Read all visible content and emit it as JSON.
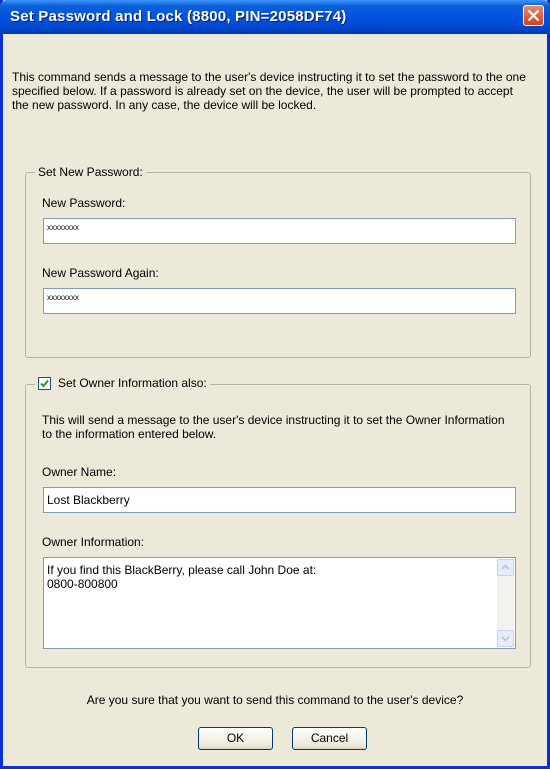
{
  "window": {
    "title": "Set Password and Lock (8800, PIN=2058DF74)"
  },
  "intro": {
    "text": "This command sends a message to the user's device instructing it to set the password to the one specified below. If a password is already set on the device, the user will be prompted to accept the new password. In any case, the device will be locked."
  },
  "password_group": {
    "legend": "Set New Password:",
    "new_password_label": "New Password:",
    "new_password_value": "xxxxxxxx",
    "again_label": "New Password Again:",
    "again_value": "xxxxxxxx"
  },
  "owner_group": {
    "checkbox_label": "Set Owner Information also:",
    "checked": true,
    "description": "This will send a message to the user's device instructing it to set the Owner Information to the information entered below.",
    "owner_name_label": "Owner Name:",
    "owner_name_value": "Lost Blackberry",
    "owner_info_label": "Owner Information:",
    "owner_info_value": "If you find this BlackBerry, please call John Doe at:\n0800-800800"
  },
  "confirm": {
    "text": "Are you sure that you want to send this command to the user's device?"
  },
  "buttons": {
    "ok": "OK",
    "cancel": "Cancel"
  }
}
